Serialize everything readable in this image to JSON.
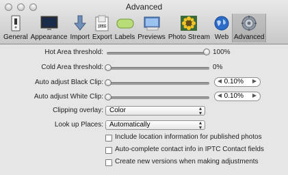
{
  "window": {
    "title": "Advanced"
  },
  "toolbar": [
    {
      "label": "General",
      "icon": "switch-icon"
    },
    {
      "label": "Appearance",
      "icon": "monitor-icon"
    },
    {
      "label": "Import",
      "icon": "import-arrow-icon"
    },
    {
      "label": "Export",
      "icon": "export-document-icon"
    },
    {
      "label": "Labels",
      "icon": "label-tag-icon"
    },
    {
      "label": "Previews",
      "icon": "previews-icon"
    },
    {
      "label": "Photo Stream",
      "icon": "photo-stream-icon"
    },
    {
      "label": "Web",
      "icon": "web-globe-icon"
    },
    {
      "label": "Advanced",
      "icon": "advanced-gear-icon",
      "selected": true
    }
  ],
  "settings": {
    "hot_area": {
      "label": "Hot Area threshold:",
      "value": "100%",
      "level": 1.0
    },
    "cold_area": {
      "label": "Cold Area threshold:",
      "value": "0%",
      "level": 0.0
    },
    "black_clip": {
      "label": "Auto adjust Black Clip:",
      "value": "0.10%",
      "level": 0.0
    },
    "white_clip": {
      "label": "Auto adjust White Clip:",
      "value": "0.10%",
      "level": 0.0
    },
    "clipping_overlay": {
      "label": "Clipping overlay:",
      "value": "Color"
    },
    "look_up_places": {
      "label": "Look up Places:",
      "value": "Automatically"
    },
    "checkboxes": [
      {
        "label": "Include location information for published photos",
        "checked": false
      },
      {
        "label": "Auto-complete contact info in IPTC Contact fields",
        "checked": false
      },
      {
        "label": "Create new versions when making adjustments",
        "checked": false
      }
    ]
  }
}
